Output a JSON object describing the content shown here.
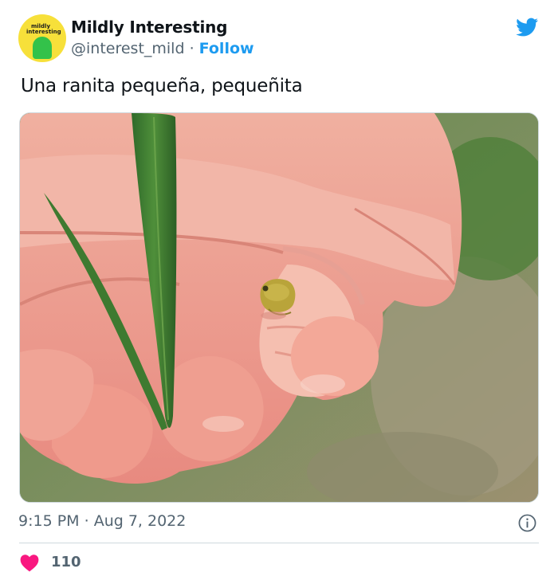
{
  "account": {
    "display_name": "Mildly Interesting",
    "handle": "@interest_mild",
    "separator": "·",
    "follow_label": "Follow",
    "avatar_text": "mildly interesting"
  },
  "tweet": {
    "text": "Una ranita pequeña, pequeñita",
    "time": "9:15 PM",
    "date": "Aug 7, 2022",
    "meta_separator": "·"
  },
  "engagement": {
    "likes": "110"
  },
  "colors": {
    "brand_blue": "#1d9bf0",
    "like_pink": "#f91880",
    "muted_text": "#536471"
  },
  "icons": {
    "logo": "twitter-bird-icon",
    "info": "info-icon",
    "like": "heart-icon"
  }
}
